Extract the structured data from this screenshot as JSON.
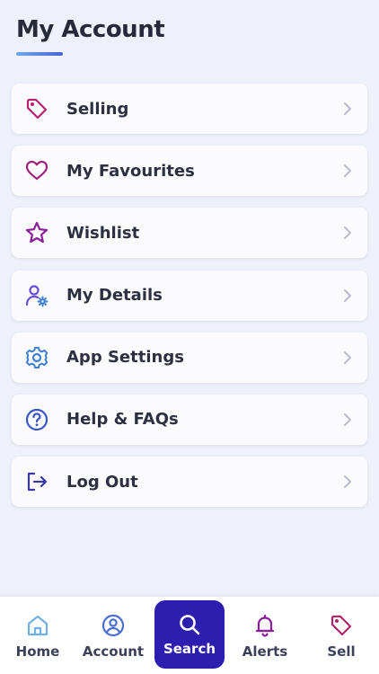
{
  "header": {
    "title": "My Account"
  },
  "menu": {
    "items": [
      {
        "label": "Selling",
        "icon": "tag-icon"
      },
      {
        "label": "My Favourites",
        "icon": "heart-icon"
      },
      {
        "label": "Wishlist",
        "icon": "star-icon"
      },
      {
        "label": "My Details",
        "icon": "user-settings-icon"
      },
      {
        "label": "App Settings",
        "icon": "gear-icon"
      },
      {
        "label": "Help & FAQs",
        "icon": "question-icon"
      },
      {
        "label": "Log Out",
        "icon": "logout-icon"
      }
    ]
  },
  "tabbar": {
    "tabs": [
      {
        "label": "Home",
        "icon": "home-icon"
      },
      {
        "label": "Account",
        "icon": "account-icon"
      },
      {
        "label": "Search",
        "icon": "search-icon",
        "active": true
      },
      {
        "label": "Alerts",
        "icon": "bell-icon"
      },
      {
        "label": "Sell",
        "icon": "tag-icon"
      }
    ]
  },
  "colors": {
    "background": "#eef0fa",
    "card": "#fbfbfe",
    "active_tab": "#2c1fb0",
    "magenta": "#b3246e",
    "purple": "#8a1f99",
    "violet": "#6a4fd8",
    "blue": "#3e7fd0",
    "indigo": "#3a35a8"
  }
}
